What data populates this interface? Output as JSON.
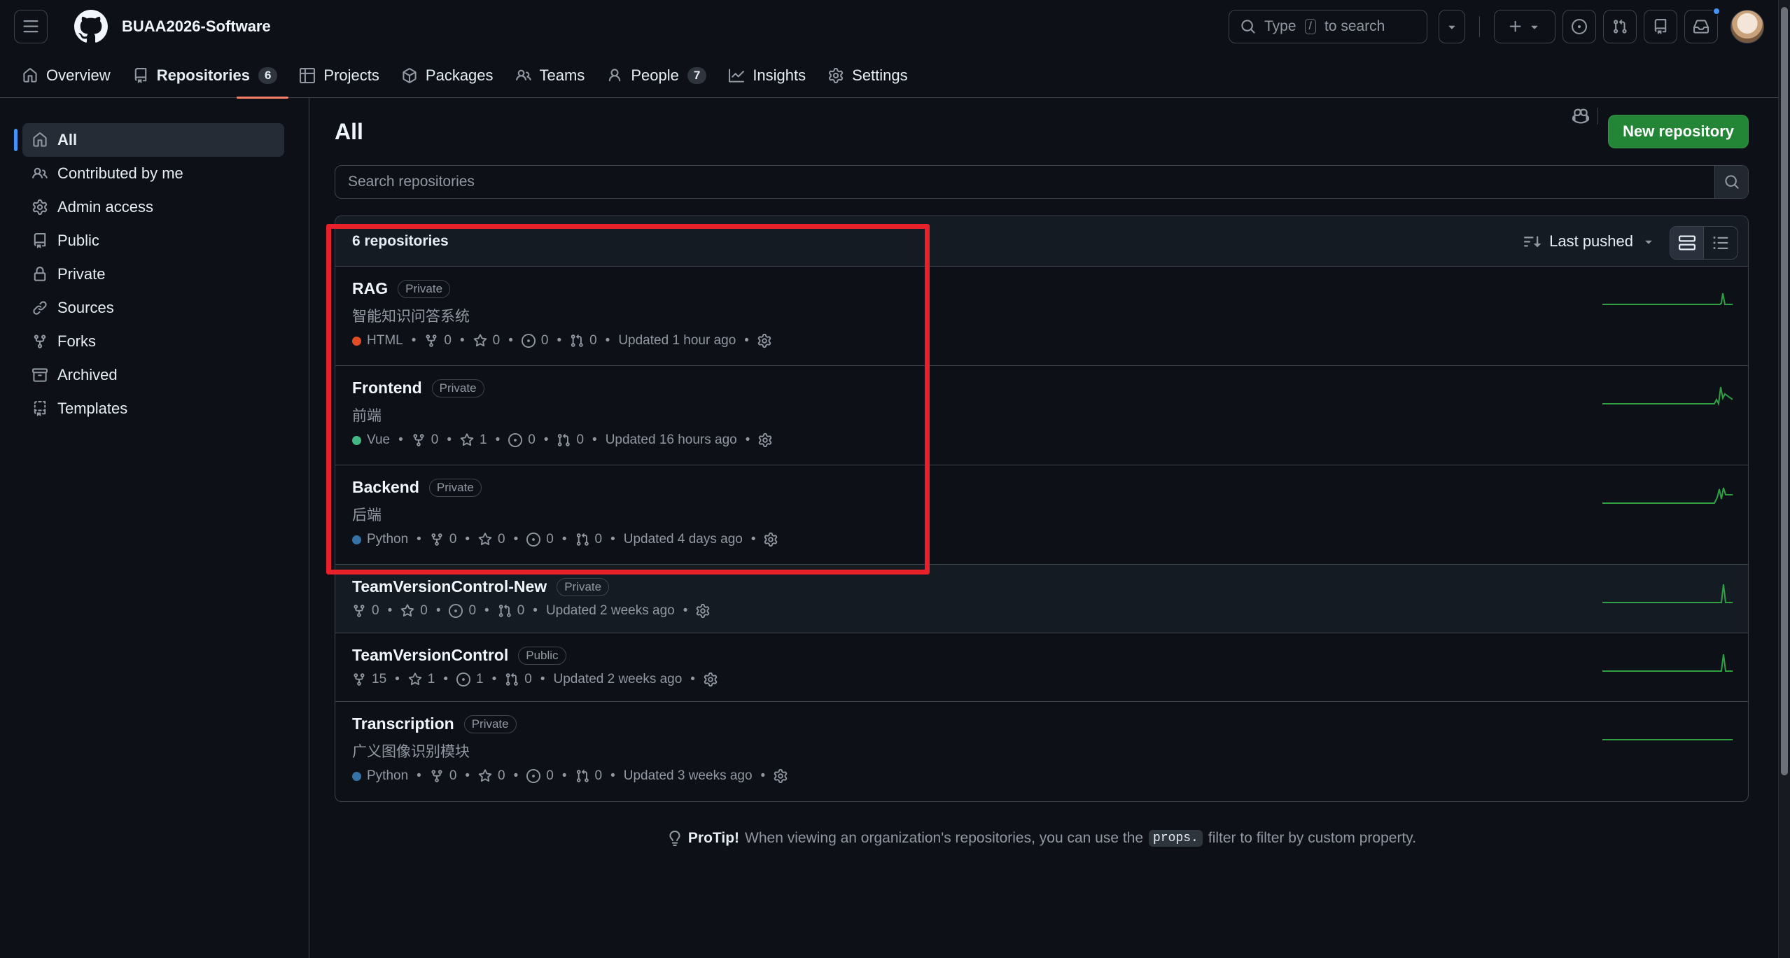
{
  "header": {
    "org_name": "BUAA2026-Software",
    "search_placeholder_pre": "Type",
    "search_key": "/",
    "search_placeholder_post": "to search"
  },
  "nav": {
    "tabs": [
      {
        "label": "Overview",
        "icon": "home-icon"
      },
      {
        "label": "Repositories",
        "icon": "repo-icon",
        "count": "6"
      },
      {
        "label": "Projects",
        "icon": "table-icon"
      },
      {
        "label": "Packages",
        "icon": "package-icon"
      },
      {
        "label": "Teams",
        "icon": "people-icon"
      },
      {
        "label": "People",
        "icon": "person-icon",
        "count": "7"
      },
      {
        "label": "Insights",
        "icon": "graph-icon"
      },
      {
        "label": "Settings",
        "icon": "gear-icon"
      }
    ]
  },
  "sidebar": {
    "items": [
      {
        "label": "All",
        "icon": "home-icon"
      },
      {
        "label": "Contributed by me",
        "icon": "people-icon"
      },
      {
        "label": "Admin access",
        "icon": "gear-icon"
      },
      {
        "label": "Public",
        "icon": "repo-icon"
      },
      {
        "label": "Private",
        "icon": "lock-repo-icon"
      },
      {
        "label": "Sources",
        "icon": "link-icon"
      },
      {
        "label": "Forks",
        "icon": "fork-icon"
      },
      {
        "label": "Archived",
        "icon": "archive-icon"
      },
      {
        "label": "Templates",
        "icon": "template-icon"
      }
    ]
  },
  "main": {
    "title": "All",
    "new_repo_label": "New repository",
    "search_placeholder": "Search repositories",
    "repo_count": "6 repositories",
    "sort_label": "Last pushed",
    "protip_strong": "ProTip!",
    "protip_text_1": "When viewing an organization's repositories, you can use the",
    "protip_code": "props.",
    "protip_text_2": "filter to filter by custom property."
  },
  "repos": [
    {
      "name": "RAG",
      "visibility": "Private",
      "description": "智能知识问答系统",
      "language": "HTML",
      "lang_color": "#e34c26",
      "forks": "0",
      "stars": "0",
      "issues": "0",
      "prs": "0",
      "updated": "Updated 1 hour ago"
    },
    {
      "name": "Frontend",
      "visibility": "Private",
      "description": "前端",
      "language": "Vue",
      "lang_color": "#41b883",
      "forks": "0",
      "stars": "1",
      "issues": "0",
      "prs": "0",
      "updated": "Updated 16 hours ago"
    },
    {
      "name": "Backend",
      "visibility": "Private",
      "description": "后端",
      "language": "Python",
      "lang_color": "#3572A5",
      "forks": "0",
      "stars": "0",
      "issues": "0",
      "prs": "0",
      "updated": "Updated 4 days ago"
    },
    {
      "name": "TeamVersionControl-New",
      "visibility": "Private",
      "description": "",
      "language": "",
      "lang_color": "",
      "forks": "0",
      "stars": "0",
      "issues": "0",
      "prs": "0",
      "updated": "Updated 2 weeks ago"
    },
    {
      "name": "TeamVersionControl",
      "visibility": "Public",
      "description": "",
      "language": "",
      "lang_color": "",
      "forks": "15",
      "stars": "1",
      "issues": "1",
      "prs": "0",
      "updated": "Updated 2 weeks ago"
    },
    {
      "name": "Transcription",
      "visibility": "Private",
      "description": "广义图像识别模块",
      "language": "Python",
      "lang_color": "#3572A5",
      "forks": "0",
      "stars": "0",
      "issues": "0",
      "prs": "0",
      "updated": "Updated 3 weeks ago"
    }
  ],
  "colors": {
    "accent": "#4493f8",
    "primary_button": "#238636",
    "active_tab_underline": "#f78166",
    "highlight_box": "#e8202a",
    "sparkline": "#2ea043"
  }
}
